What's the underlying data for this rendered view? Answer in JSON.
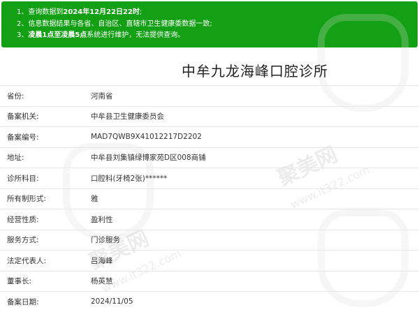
{
  "notice": {
    "l1_pre": "1、查询数据到",
    "l1_bold": "2024年12月22日22时",
    "l1_post": ";",
    "l2": "2、信息数据结果与各省、自治区、直辖市卫生健康委数据一致;",
    "l3_pre": "3、",
    "l3_bold": "凌晨1点至凌晨5点",
    "l3_post": "系统进行维护，无法提供查询。"
  },
  "clinic": {
    "name": "中牟九龙海峰口腔诊所"
  },
  "watermark": {
    "text1": "聚美网",
    "sub1": "www.it322.com",
    "text2": "聚美网",
    "sub2": "www.it322.com"
  },
  "rows": [
    {
      "label": "省份:",
      "value": "河南省"
    },
    {
      "label": "备案机关:",
      "value": "中牟县卫生健康委员会"
    },
    {
      "label": "备案编号:",
      "value": "MAD7QWB9X41012217D2202"
    },
    {
      "label": "地址:",
      "value": "中牟县刘集镇绿博家苑D区008商铺"
    },
    {
      "label": "诊所科目:",
      "value": "口腔科(牙椅2张)******"
    },
    {
      "label": "所有制形式:",
      "value": "雅"
    },
    {
      "label": "经营性质:",
      "value": "盈利性"
    },
    {
      "label": "服务方式:",
      "value": "门诊服务"
    },
    {
      "label": "法定代表人:",
      "value": "吕海峰"
    },
    {
      "label": "董事长:",
      "value": "杨英慧"
    },
    {
      "label": "备案日期:",
      "value": "2024/11/05"
    }
  ]
}
